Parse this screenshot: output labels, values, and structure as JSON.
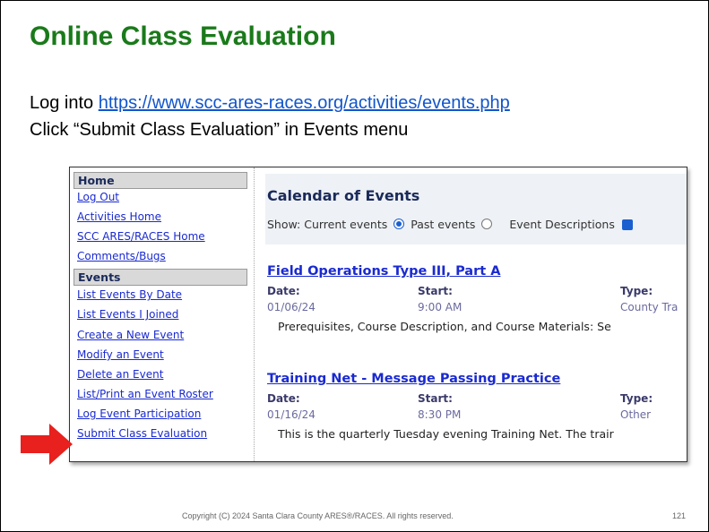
{
  "slide": {
    "title": "Online Class Evaluation",
    "line1_prefix": "Log into ",
    "line1_link": "https://www.scc-ares-races.org/activities/events.php",
    "line2": "Click “Submit Class Evaluation” in Events menu",
    "footer": "Copyright (C) 2024 Santa Clara County ARES®/RACES. All rights reserved.",
    "page_number": "121"
  },
  "sidebar": {
    "home_header": "Home",
    "home_links": [
      "Log Out",
      "Activities Home",
      "SCC ARES/RACES Home",
      "Comments/Bugs"
    ],
    "events_header": "Events",
    "event_links": [
      "List Events By Date",
      "List Events I Joined",
      "Create a New Event",
      "Modify an Event",
      "Delete an Event",
      "List/Print an Event Roster",
      "Log Event Participation",
      "Submit Class Evaluation"
    ]
  },
  "main": {
    "title": "Calendar of Events",
    "show_label": "Show: Current events",
    "past_label": "Past events",
    "desc_label": "Event Descriptions",
    "selected_filter": "Current events",
    "event_descriptions_checked": true
  },
  "events": [
    {
      "title": "Field Operations Type III, Part A",
      "date_label": "Date:",
      "start_label": "Start:",
      "type_label": "Type:",
      "date": "01/06/24",
      "start": "9:00 AM",
      "type": "County Tra",
      "desc": "Prerequisites, Course Description, and Course Materials: Se"
    },
    {
      "title": "Training Net - Message Passing Practice",
      "date_label": "Date:",
      "start_label": "Start:",
      "type_label": "Type:",
      "date": "01/16/24",
      "start": "8:30 PM",
      "type": "Other",
      "desc": "This is the quarterly Tuesday evening Training Net. The trair"
    }
  ],
  "colors": {
    "title_green": "#1a7a1a",
    "link_blue": "#1a2ad0",
    "arrow_red": "#e8201e"
  }
}
